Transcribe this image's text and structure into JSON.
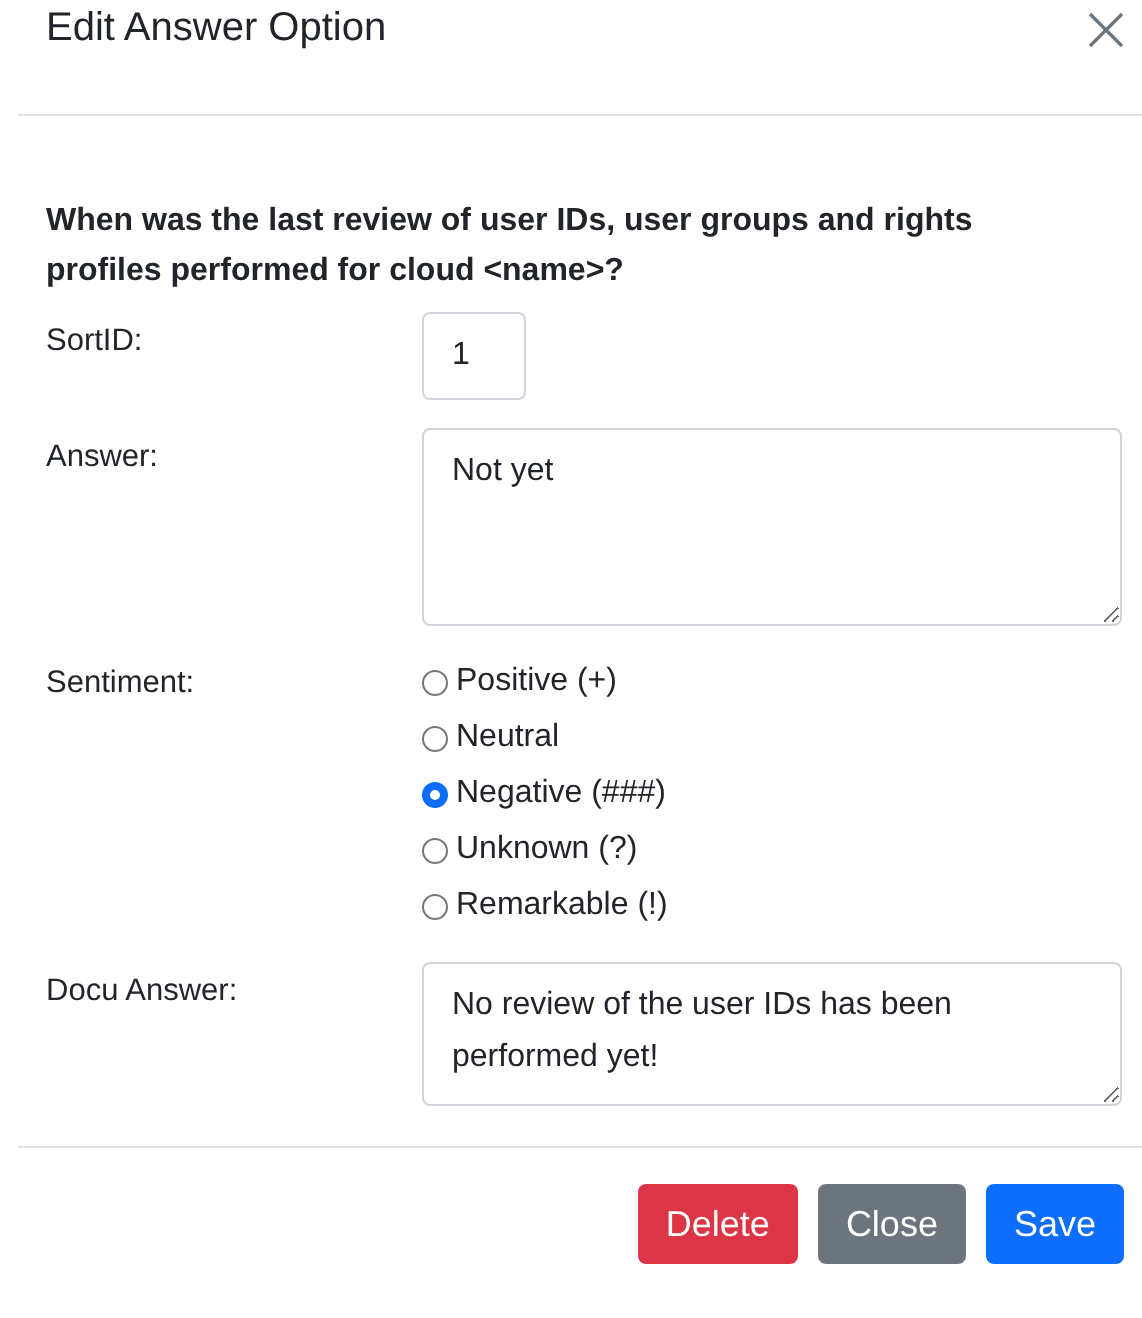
{
  "dialog": {
    "title": "Edit Answer Option"
  },
  "question": "When was the last review of user IDs, user groups and rights profiles performed for cloud <name>?",
  "fields": [
    {
      "kind": "input",
      "label": "SortID:",
      "value": "1"
    },
    {
      "kind": "textarea",
      "label": "Answer:",
      "value": "Not yet"
    },
    {
      "kind": "radio",
      "label": "Sentiment:",
      "options": [
        {
          "label": "Positive (+)",
          "selected": false
        },
        {
          "label": "Neutral",
          "selected": false
        },
        {
          "label": "Negative (###)",
          "selected": true
        },
        {
          "label": "Unknown (?)",
          "selected": false
        },
        {
          "label": "Remarkable (!)",
          "selected": false
        }
      ]
    },
    {
      "kind": "textarea-short",
      "label": "Docu Answer:",
      "value": "No review of the user IDs has been performed yet!"
    }
  ],
  "buttons": [
    {
      "label": "Delete",
      "kind": "danger"
    },
    {
      "label": "Close",
      "kind": "secondary"
    },
    {
      "label": "Save",
      "kind": "primary"
    }
  ]
}
